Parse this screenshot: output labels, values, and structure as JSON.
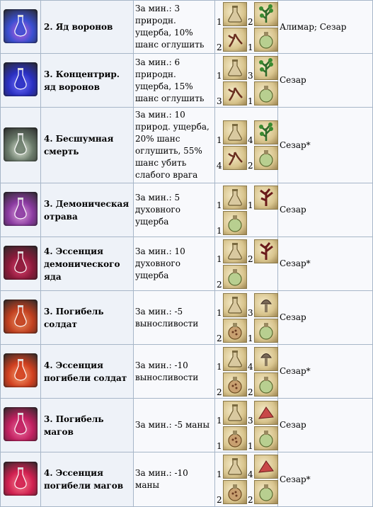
{
  "rows": [
    {
      "name": "2. Яд воронов",
      "effect": "За мин.: 3 природн. ущерба, 10% шанс оглушить",
      "source": "Алимар; Сезар",
      "potion_colors": [
        "#3a4fd0",
        "#c060e0"
      ],
      "ingredients": [
        {
          "qty": "1",
          "icon": "flask-icon"
        },
        {
          "qty": "2",
          "icon": "herb-icon"
        },
        {
          "qty": "2",
          "icon": "root-icon"
        },
        {
          "qty": "1",
          "icon": "vial-icon"
        }
      ]
    },
    {
      "name": "3. Концентрир. яд воронов",
      "effect": "За мин.: 6 природн. ущерба, 15% шанс оглушить",
      "source": "Сезар",
      "potion_colors": [
        "#2a2fc0",
        "#7070ff"
      ],
      "ingredients": [
        {
          "qty": "1",
          "icon": "flask-icon"
        },
        {
          "qty": "3",
          "icon": "herb-icon"
        },
        {
          "qty": "3",
          "icon": "root-icon"
        },
        {
          "qty": "1",
          "icon": "vial-icon"
        }
      ]
    },
    {
      "name": "4. Бесшумная смерть",
      "effect": "За мин.: 10 природ. ущерба, 20% шанс оглушить, 55% шанс убить слабого врага",
      "source": "Сезар*",
      "potion_colors": [
        "#6a7a6a",
        "#e8f0e0"
      ],
      "ingredients": [
        {
          "qty": "1",
          "icon": "flask-icon"
        },
        {
          "qty": "4",
          "icon": "herb-icon"
        },
        {
          "qty": "4",
          "icon": "root-icon"
        },
        {
          "qty": "2",
          "icon": "vial-icon"
        }
      ]
    },
    {
      "name": "3. Демоническая отрава",
      "effect": "За мин.: 5 духовного ущерба",
      "source": "Сезар",
      "potion_colors": [
        "#8a3aa0",
        "#e0a0e0"
      ],
      "ingredients": [
        {
          "qty": "1",
          "icon": "flask-icon"
        },
        {
          "qty": "1",
          "icon": "demon-herb-icon"
        },
        {
          "qty": "1",
          "icon": "vial-icon"
        }
      ]
    },
    {
      "name": "4. Эссенция демонического яда",
      "effect": "За мин.: 10 духовного ущерба",
      "source": "Сезар*",
      "potion_colors": [
        "#8a1a3a",
        "#e04070"
      ],
      "ingredients": [
        {
          "qty": "1",
          "icon": "flask-icon"
        },
        {
          "qty": "2",
          "icon": "demon-herb-icon"
        },
        {
          "qty": "2",
          "icon": "vial-icon"
        }
      ]
    },
    {
      "name": "3. Погибель солдат",
      "effect": "За мин.: -5 выносливости",
      "source": "Сезар",
      "potion_colors": [
        "#c04020",
        "#f09060"
      ],
      "ingredients": [
        {
          "qty": "1",
          "icon": "flask-icon"
        },
        {
          "qty": "3",
          "icon": "mushroom-icon"
        },
        {
          "qty": "2",
          "icon": "seed-vial-icon"
        },
        {
          "qty": "1",
          "icon": "vial-icon"
        }
      ]
    },
    {
      "name": "4. Эссенция погибели солдат",
      "effect": "За мин.: -10 выносливости",
      "source": "Сезар*",
      "potion_colors": [
        "#d04020",
        "#f8a070"
      ],
      "ingredients": [
        {
          "qty": "1",
          "icon": "flask-icon"
        },
        {
          "qty": "4",
          "icon": "mushroom-icon"
        },
        {
          "qty": "2",
          "icon": "seed-vial-icon"
        },
        {
          "qty": "2",
          "icon": "vial-icon"
        }
      ]
    },
    {
      "name": "3. Погибель магов",
      "effect": "За мин.: -5 маны",
      "source": "Сезар",
      "potion_colors": [
        "#c02060",
        "#f070a0"
      ],
      "ingredients": [
        {
          "qty": "1",
          "icon": "flask-icon"
        },
        {
          "qty": "3",
          "icon": "crystal-icon"
        },
        {
          "qty": "1",
          "icon": "seed-vial-icon"
        },
        {
          "qty": "1",
          "icon": "vial-icon"
        }
      ]
    },
    {
      "name": "4. Эссенция погибели магов",
      "effect": "За мин.: -10 маны",
      "source": "Сезар*",
      "potion_colors": [
        "#d02050",
        "#f88090"
      ],
      "ingredients": [
        {
          "qty": "1",
          "icon": "flask-icon"
        },
        {
          "qty": "4",
          "icon": "crystal-icon"
        },
        {
          "qty": "2",
          "icon": "seed-vial-icon"
        },
        {
          "qty": "2",
          "icon": "vial-icon"
        }
      ]
    }
  ]
}
